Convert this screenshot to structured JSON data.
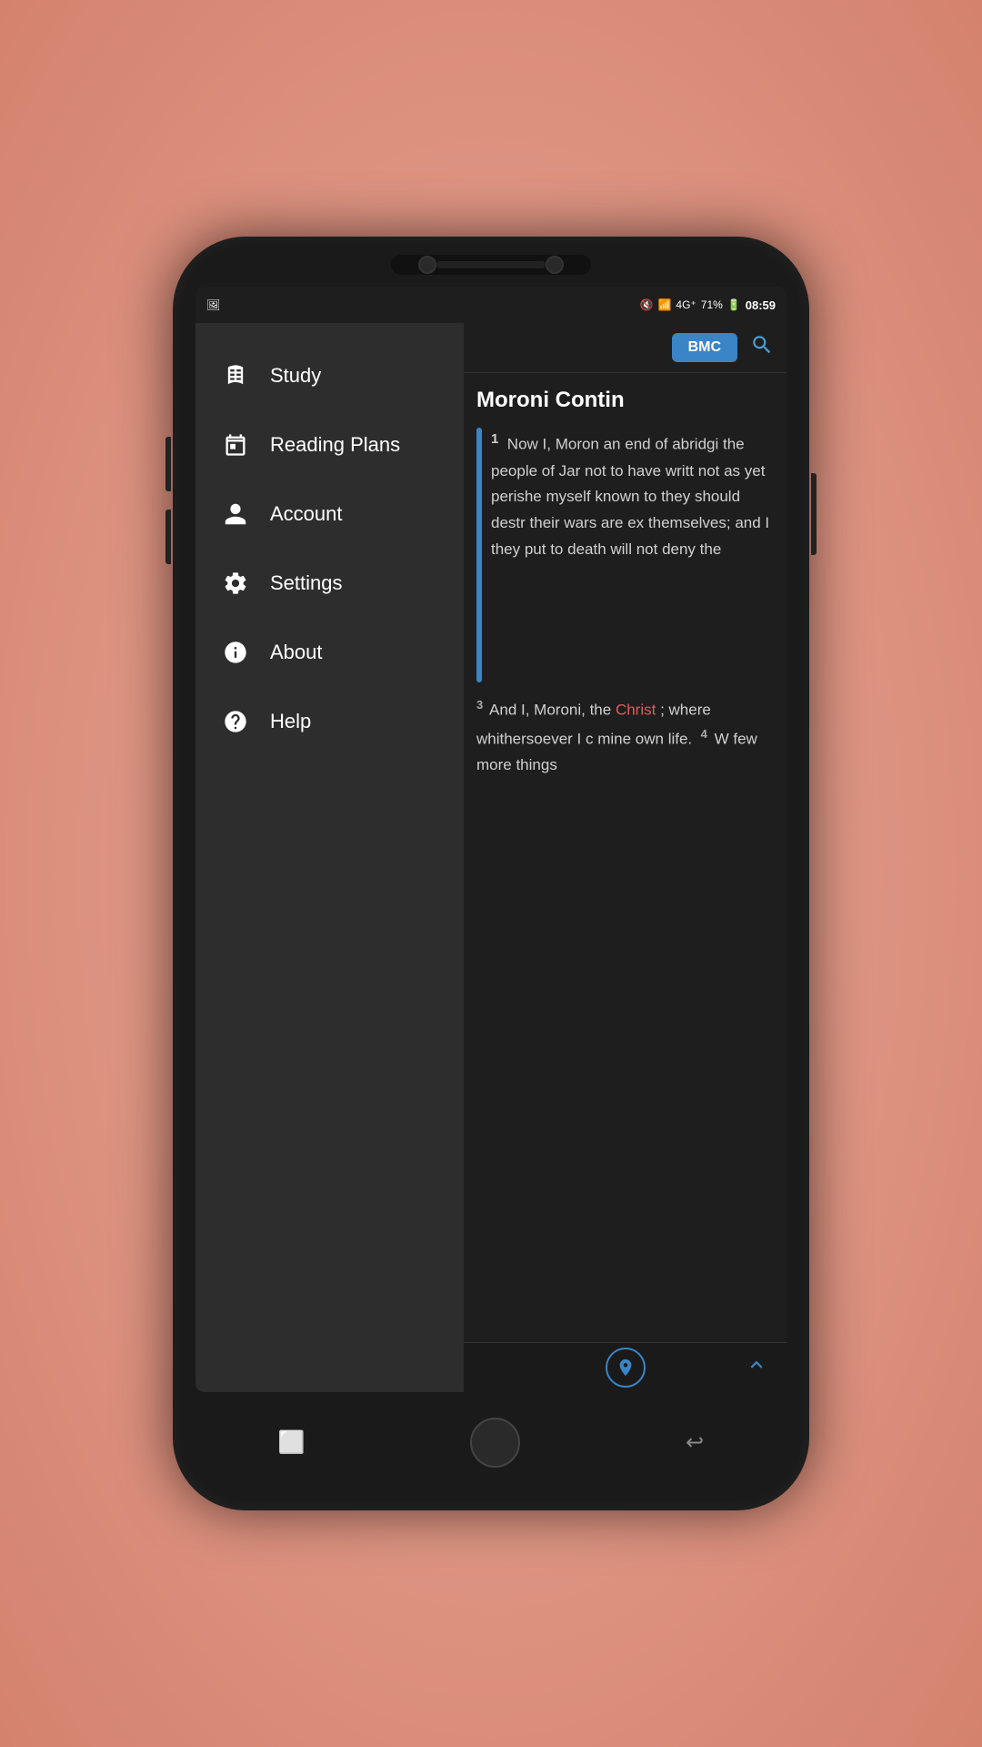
{
  "statusBar": {
    "time": "08:59",
    "battery": "71%",
    "signal": "4G+"
  },
  "toolbar": {
    "bmcLabel": "BMC",
    "searchIconLabel": "🔍"
  },
  "sidebar": {
    "items": [
      {
        "id": "study",
        "label": "Study",
        "icon": "book"
      },
      {
        "id": "reading-plans",
        "label": "Reading Plans",
        "icon": "calendar"
      },
      {
        "id": "account",
        "label": "Account",
        "icon": "user"
      },
      {
        "id": "settings",
        "label": "Settings",
        "icon": "gear"
      },
      {
        "id": "about",
        "label": "About",
        "icon": "info"
      },
      {
        "id": "help",
        "label": "Help",
        "icon": "question"
      }
    ]
  },
  "reading": {
    "chapterTitle": "Moroni Contin",
    "verseNumber": "1",
    "verseText": "Now I, Moron an end of abridgi the people of Jar not to have writt not as yet perishe myself known to they should destr their wars are ex themselves; and I they put to death will not deny the",
    "verse3Number": "3",
    "verse3Text": "And I, Moroni, the ",
    "verse3Highlight": "Christ",
    "verse3Cont": "; where whithersoever I c mine own life.",
    "verse4Number": "4",
    "verse4Text": "W few more things"
  },
  "bottomBar": {
    "locationIcon": "📍",
    "scrollUpIcon": "▲"
  },
  "phoneNav": {
    "recentIcon": "⬜",
    "backIcon": "↩"
  }
}
